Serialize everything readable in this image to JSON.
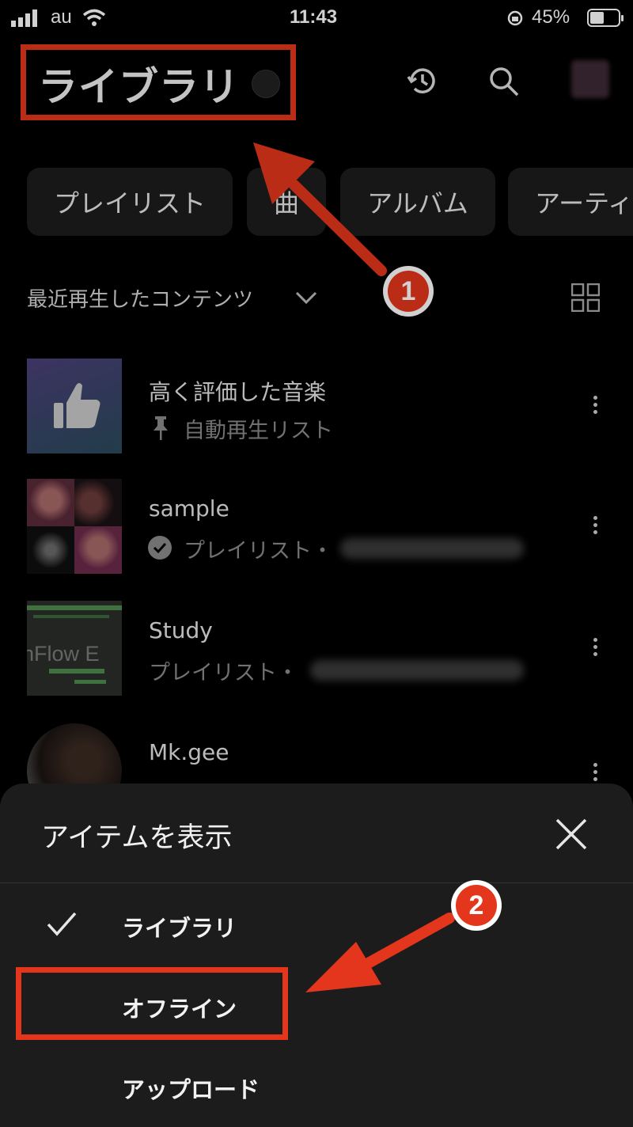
{
  "status_bar": {
    "carrier": "au",
    "time": "11:43",
    "battery": "45%"
  },
  "header": {
    "title": "ライブラリ"
  },
  "chips": [
    "プレイリスト",
    "曲",
    "アルバム",
    "アーティ"
  ],
  "section": {
    "label": "最近再生したコンテンツ"
  },
  "items": [
    {
      "title": "高く評価した音楽",
      "subtitle": "自動再生リスト"
    },
    {
      "title": "sample",
      "subtitle": "プレイリスト・"
    },
    {
      "title": "Study",
      "subtitle": "プレイリスト・",
      "thumb_text": "nFlow E"
    },
    {
      "title": "Mk.gee"
    }
  ],
  "sheet": {
    "title": "アイテムを表示",
    "options": [
      "ライブラリ",
      "オフライン",
      "アップロード"
    ],
    "selected": "ライブラリ"
  },
  "annotations": {
    "step1": "1",
    "step2": "2"
  },
  "colors": {
    "annotation_red": "#e3361c",
    "background": "#000000",
    "sheet": "#1c1c1c"
  }
}
